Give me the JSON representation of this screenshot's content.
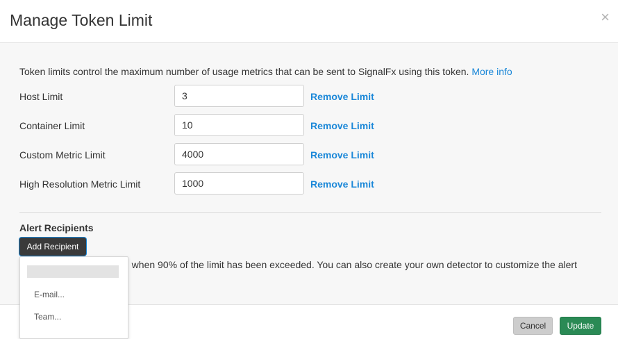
{
  "dialog": {
    "title": "Manage Token Limit",
    "close_glyph": "×"
  },
  "intro": {
    "text": "Token limits control the maximum number of usage metrics that can be sent to SignalFx using this token.",
    "link": "More info"
  },
  "limits": [
    {
      "label": "Host Limit",
      "value": "3",
      "remove": "Remove Limit"
    },
    {
      "label": "Container Limit",
      "value": "10",
      "remove": "Remove Limit"
    },
    {
      "label": "Custom Metric Limit",
      "value": "4000",
      "remove": "Remove Limit"
    },
    {
      "label": "High Resolution Metric Limit",
      "value": "1000",
      "remove": "Remove Limit"
    }
  ],
  "alerts": {
    "title": "Alert Recipients",
    "add_button": "Add Recipient",
    "note_visible": "d when 90% of the limit has been exceeded. You can also create your own detector to customize the alert"
  },
  "dropdown": {
    "items": [
      "E-mail...",
      "Team..."
    ]
  },
  "footer": {
    "cancel": "Cancel",
    "update": "Update"
  },
  "colors": {
    "link": "#1a87d8",
    "update_button": "#2a8a55",
    "add_button": "#3a3a3a"
  }
}
